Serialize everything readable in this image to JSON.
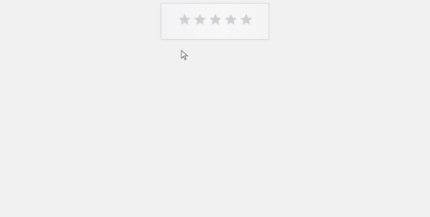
{
  "rating": {
    "value": 0,
    "max": 5,
    "star_icon": "star-icon",
    "empty_color": "#cfcfd2",
    "filled_color": "#f5b301"
  },
  "pointer": {
    "icon": "mouse-pointer-icon"
  }
}
